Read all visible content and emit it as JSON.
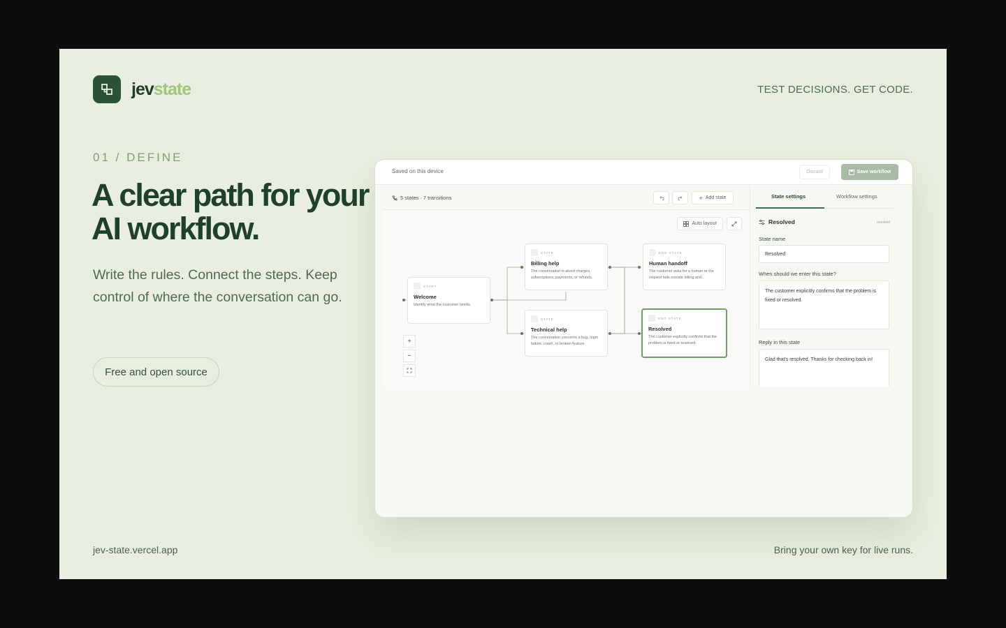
{
  "brand": {
    "name_part1": "jev",
    "name_part2": "state",
    "logo_icon": "flow-icon",
    "logo_color": "#2a5236"
  },
  "header": {
    "tagline": "TEST DECISIONS. GET CODE."
  },
  "hero": {
    "eyebrow": "01 / DEFINE",
    "headline": "A clear path for your AI workflow.",
    "subtitle": "Write the rules. Connect the steps. Keep control of where the conversation can go.",
    "pill": "Free and open source"
  },
  "footer": {
    "url": "jev-state.vercel.app",
    "note": "Bring your own key for live runs."
  },
  "app": {
    "topbar": {
      "saved": "Saved on this device",
      "discard": "Discard",
      "save": "Save workflow"
    },
    "toolbar": {
      "stats": "5 states · 7 transitions",
      "add_state": "Add state",
      "auto_layout": "Auto layout"
    },
    "nodes": [
      {
        "tag": "START",
        "title": "Welcome",
        "desc": "Identify what the customer needs."
      },
      {
        "tag": "STATE",
        "title": "Billing help",
        "desc": "The conversation is about charges, subscriptions, payments, or refunds."
      },
      {
        "tag": "STATE",
        "title": "Technical help",
        "desc": "The conversation concerns a bug, login failure, crash, or broken feature."
      },
      {
        "tag": "END STATE",
        "title": "Human handoff",
        "desc": "The customer asks for a human or the request falls outside billing and..."
      },
      {
        "tag": "END STATE",
        "title": "Resolved",
        "desc": "The customer explicitly confirms that the problem is fixed or resolved."
      }
    ],
    "panel": {
      "tab_state": "State settings",
      "tab_workflow": "Workflow settings",
      "selected": "Resolved",
      "selected_id": "resolved",
      "state_name_label": "State name",
      "state_name_value": "Resolved",
      "enter_label": "When should we enter this state?",
      "enter_value": "The customer explicitly confirms that the problem is fixed or resolved.",
      "reply_label": "Reply in this state",
      "reply_value": "Glad that's resolved. Thanks for checking back in!"
    }
  }
}
